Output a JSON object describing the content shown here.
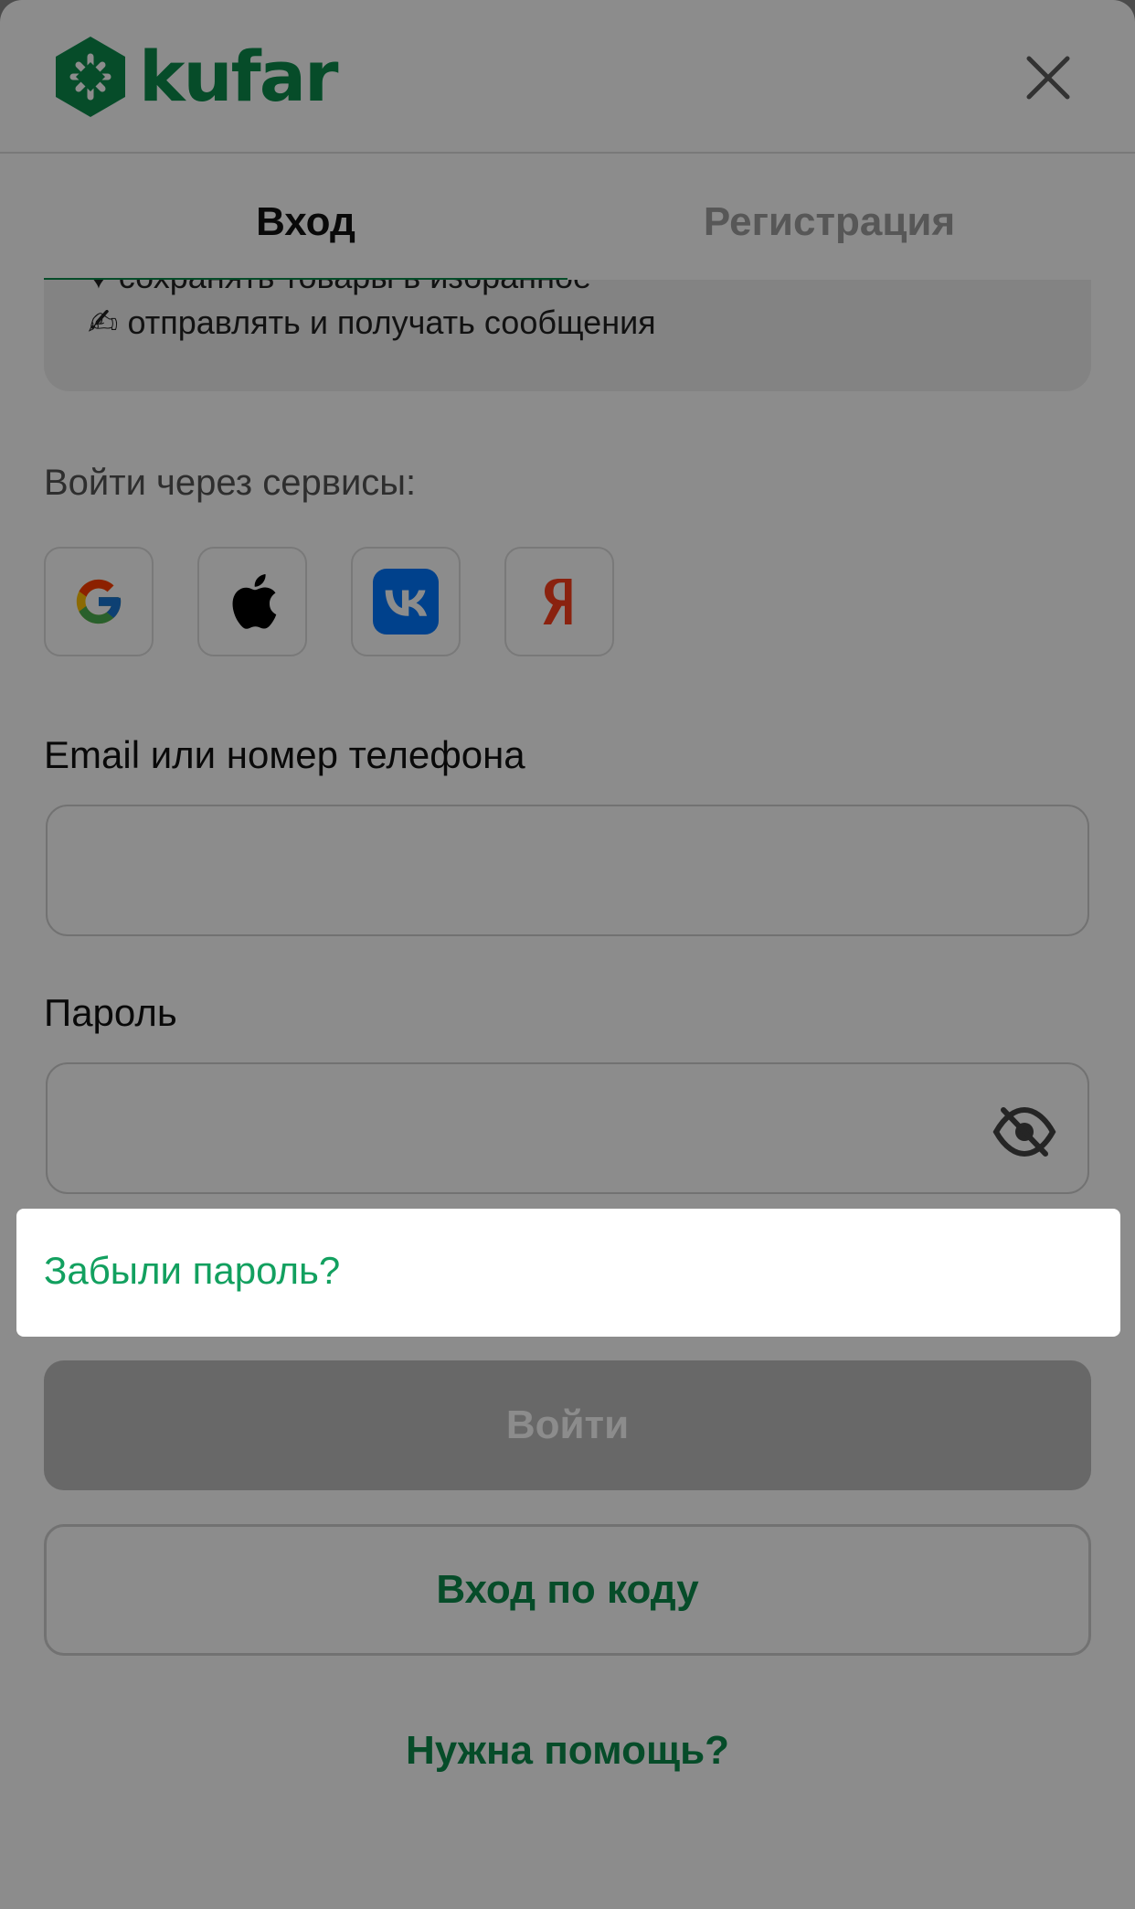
{
  "app": {
    "logo_text": "kufar"
  },
  "tabs": [
    {
      "label": "Вход",
      "active": true
    },
    {
      "label": "Регистрация",
      "active": false
    }
  ],
  "benefits": [
    {
      "icon": "heart-icon",
      "text": "сохранять товары в избранное"
    },
    {
      "icon": "writing-hand-icon",
      "text": "отправлять и получать сообщения"
    }
  ],
  "services": {
    "label": "Войти через сервисы:",
    "items": [
      {
        "name": "Google",
        "icon": "google-icon"
      },
      {
        "name": "Apple",
        "icon": "apple-icon"
      },
      {
        "name": "VK",
        "icon": "vk-icon"
      },
      {
        "name": "Яндекс",
        "icon": "yandex-icon"
      }
    ]
  },
  "form": {
    "email_label": "Email или номер телефона",
    "email_value": "",
    "password_label": "Пароль",
    "password_value": "",
    "forgot_password": "Забыли пароль?",
    "login_button": "Войти",
    "code_login_button": "Вход по коду",
    "help_link": "Нужна помощь?"
  },
  "colors": {
    "brand": "#0b8a4c",
    "link": "#12a05f",
    "overlay": "rgba(0,0,0,0.45)",
    "disabled_button": "#bdbdbd"
  }
}
